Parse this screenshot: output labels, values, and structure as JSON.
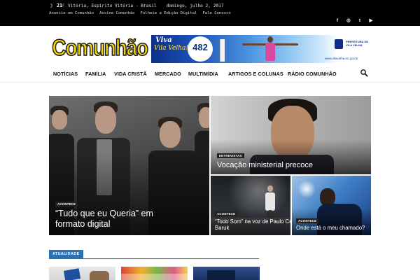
{
  "topbar": {
    "temperature": "21",
    "degree": "C",
    "location": "Vitória, Espírito Vitória - Brasil",
    "date": "domingo, julho 2, 2017",
    "links": [
      "Anuncie em Comunhão",
      "Assine Comunhão",
      "Folheie a Edição Digital",
      "Fale Conosco"
    ],
    "social": [
      {
        "icon": "facebook-icon",
        "glyph": "f"
      },
      {
        "icon": "instagram-icon",
        "glyph": "◎"
      },
      {
        "icon": "twitter-icon",
        "glyph": "t"
      },
      {
        "icon": "youtube-icon",
        "glyph": "▶"
      }
    ]
  },
  "header": {
    "logo": "Comunhão",
    "banner": {
      "line1": "Viva",
      "line2": "Vila Velha!",
      "number": "482",
      "site": "www.vilavelha.es.gov.br",
      "prefeitura": "PREFEITURA DE VILA VELHA"
    }
  },
  "nav": {
    "items": [
      "NOTÍCIAS",
      "FAMÍLIA",
      "VIDA CRISTÃ",
      "MERCADO",
      "MULTIMÍDIA",
      "ARTIGOS E COLUNAS",
      "RÁDIO COMUNHÃO"
    ]
  },
  "hero": {
    "main": {
      "category": "ACONTECE",
      "title_line1": "“Tudo que eu Queria” em",
      "title_line2": "formato digital"
    },
    "top_right": {
      "category": "ENTREVISTAS",
      "title": "Vocação ministerial precoce"
    },
    "bottom_left": {
      "category": "ACONTECE",
      "title_line1": "“Todo Som” na voz de Paulo Cé...",
      "title_line2": "Baruk"
    },
    "bottom_right": {
      "category": "ACONTECE",
      "title": "Onde está o meu chamado?"
    }
  },
  "section": {
    "label": "ATUALIDADE"
  },
  "colors": {
    "topbar": "#000000",
    "logo": "#f2d400",
    "section_accent": "#2b6fb4",
    "badge": "#222222"
  }
}
